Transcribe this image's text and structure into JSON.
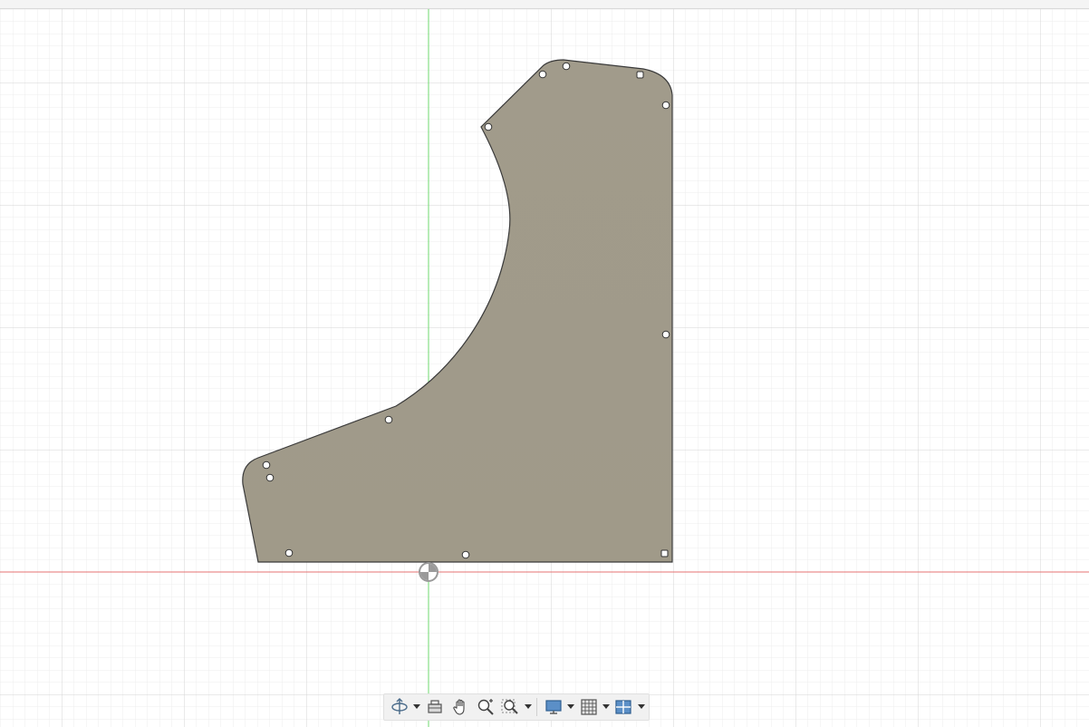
{
  "app": {
    "view": "sketch-canvas-top-view"
  },
  "colors": {
    "background": "#ffffff",
    "grid_minor": "#ececec",
    "grid_major": "#d4d4d4",
    "axis_x": "#e57373",
    "axis_y": "#6fd86f",
    "panel_fill": "#a19b8b",
    "panel_stroke": "#3a3a3a",
    "hole_fill": "#ffffff",
    "toolbar_bg": "#f1f1f1"
  },
  "toolbar": {
    "items": [
      {
        "icon": "orbit-icon",
        "has_menu": true
      },
      {
        "icon": "look-at-icon",
        "has_menu": false
      },
      {
        "icon": "pan-hand-icon",
        "has_menu": false
      },
      {
        "icon": "zoom-icon",
        "has_menu": false
      },
      {
        "icon": "zoom-window-icon",
        "has_menu": true
      },
      {
        "icon": "display-settings-icon",
        "has_menu": true
      },
      {
        "icon": "grid-snap-icon",
        "has_menu": true
      },
      {
        "icon": "viewports-icon",
        "has_menu": true
      }
    ]
  }
}
